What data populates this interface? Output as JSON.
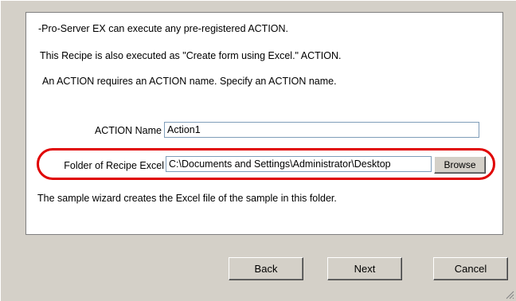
{
  "intro": {
    "line1": "-Pro-Server EX can execute any pre-registered ACTION.",
    "line2": "This Recipe is also executed as \"Create form using Excel.\" ACTION.",
    "line3": "An ACTION requires an ACTION  name. Specify an ACTION name."
  },
  "action_name": {
    "label": "ACTION Name",
    "value": "Action1"
  },
  "recipe_folder": {
    "label": "Folder of Recipe Excel",
    "value": "C:\\Documents and Settings\\Administrator\\Desktop",
    "browse_label": "Browse"
  },
  "note": "The sample wizard creates the Excel file of the sample in this folder.",
  "footer": {
    "back_label": "Back",
    "next_label": "Next",
    "cancel_label": "Cancel"
  },
  "colors": {
    "highlight": "#e00000",
    "window_bg": "#d4d0c8"
  }
}
